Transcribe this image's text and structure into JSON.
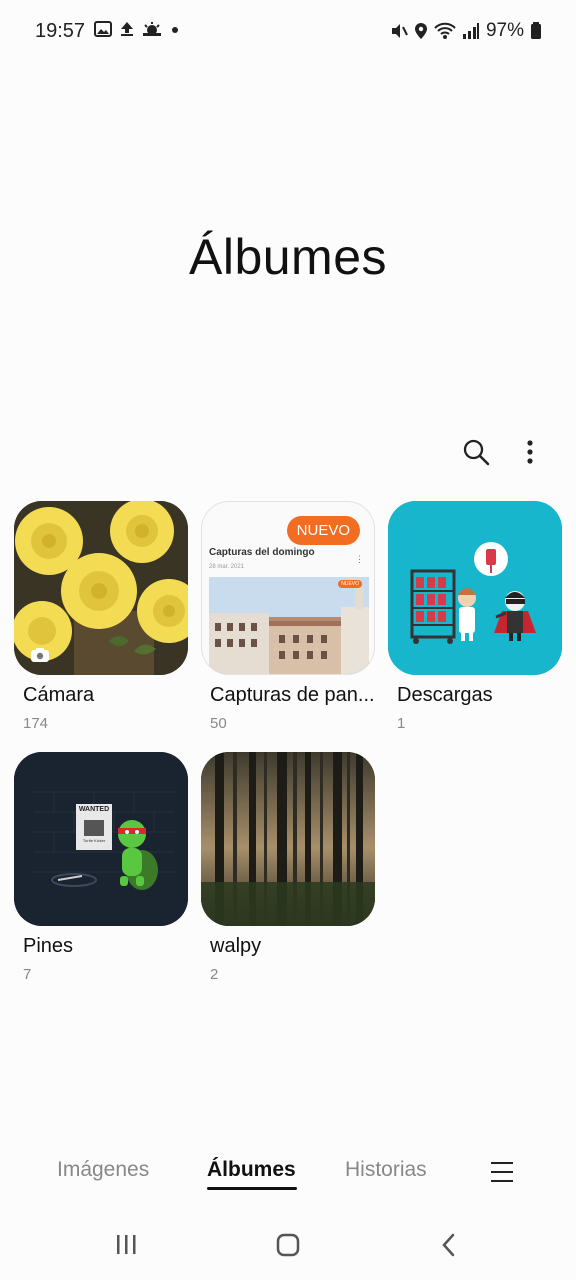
{
  "status_bar": {
    "time": "19:57",
    "battery": "97%",
    "icons_left": [
      "gallery-icon",
      "upload-icon",
      "weather-icon",
      "dot-icon"
    ],
    "icons_right": [
      "mute-vibrate-icon",
      "location-icon",
      "wifi-icon",
      "signal-icon",
      "battery-icon"
    ]
  },
  "page": {
    "title": "Álbumes"
  },
  "albums": [
    {
      "name": "Cámara",
      "count": "174"
    },
    {
      "name": "Capturas de pan...",
      "count": "50",
      "badge": "NUEVO"
    },
    {
      "name": "Descargas",
      "count": "1"
    },
    {
      "name": "Pines",
      "count": "7"
    },
    {
      "name": "walpy",
      "count": "2"
    }
  ],
  "capturas_preview": {
    "heading": "Capturas del domingo",
    "date": "28 mar. 2021",
    "badge": "NUEVO"
  },
  "pines_preview": {
    "poster_title": "WANTED",
    "poster_sub": "Turtle Kicker"
  },
  "tabs": [
    {
      "label": "Imágenes"
    },
    {
      "label": "Álbumes"
    },
    {
      "label": "Historias"
    }
  ],
  "colors": {
    "accent_badge": "#f26c22",
    "background": "#fcfcfc",
    "descargas_bg": "#18b6cc"
  }
}
